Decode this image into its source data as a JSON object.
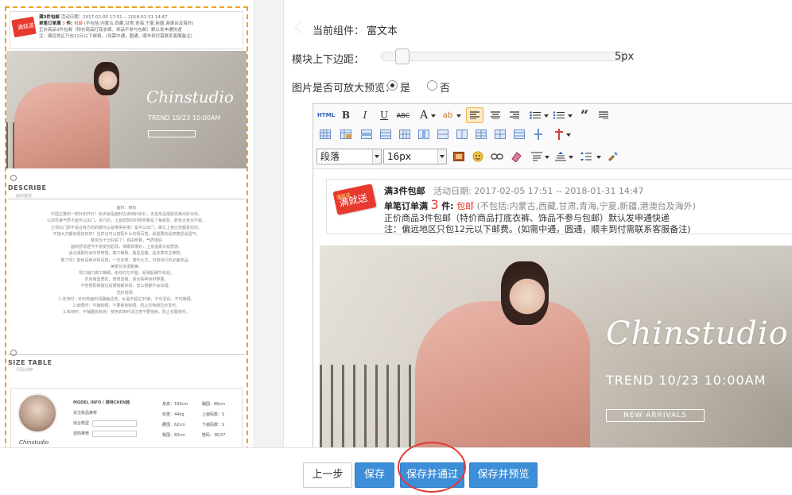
{
  "colors": {
    "accent": "#3d8ed8",
    "promo_red": "#e8392e",
    "dashed_border": "#f0a020",
    "annotation_red": "#e53935"
  },
  "preview": {
    "promo": {
      "line1_title": "满3件包邮",
      "line1_date": "活动日期：2017-02-05 17:51 -- 2018-01-31 14:47",
      "line2_prefix": "单笔订单满",
      "line2_num": "3",
      "line2_suffix": "件:",
      "line2_tag": "包邮",
      "line2_detail": "(不包括:内蒙古,西藏,甘肃,青海,宁夏,新疆,港澳台及海外)",
      "line3": "正价商品3件包邮（特价商品打底衣裤、饰品不参与包邮）默认发申通快递",
      "line4": "注：偏远地区只包12元以下邮费。(如需中通，圆通，顺丰到付需联系客服备注)",
      "tag_text": "满就送"
    },
    "hero_title": "Chinstudio",
    "hero_trend": "TREND 10/23 10:00AM",
    "describe_title": "DESCRIBE",
    "describe_sub": "面料描述",
    "describe_lines": [
      "面料：棉织",
      "中国主推的一款针织开衫！秋天就是面料应该纯针织衫，无需单品搭配完美出彩出现，",
      "以前优美气质不能可以出门，多行的，上面样款的时候穿着是了每条款，颜色大家也不错，",
      "立领出门即不适合有方的的都可以是哦得实哦！是可以出门，做工上身比较都喜欢的。",
      "不错大方都有很好的的！当然也可以搭配什么的很百搭，最重要的是穿着舒适透气。",
      "整体也十分好看了！自由穿着，气质很好",
      "面料舒适透气不易变形起球，保暖效果好，上身温柔又有质感。",
      "适合通勤约会日常穿搭，做工精致，版型显瘦，是本季的主推款。",
      "敬了吗？颜色是绝对的百搭，一衣多穿，简约大方，日常出行的必备单品。",
      "美丽又浪漫甜美。",
      "领口袖口做工精细，走线均匀平整，经得起细节考验。",
      "衣身版型宽松，遮肉显瘦，适合各种身材穿着。",
      "不管搭配裤装还是裙装都好看，怎么搭都不会出错。",
      "洗护说明：",
      "1.洗涤时：针织类面料请翻面清洗，水温不超过30度，不可漂白，不可暴晒。",
      "2.晾晒时：平铺晾晒，不要悬挂晾晒，防止衣物被拉长变形。",
      "3.收纳时：平铺叠放收纳，使用衣架时请注意不要挂肩，防止衣服变形。"
    ],
    "size_title": "SIZE TABLE",
    "size_sub": "尺码/试穿",
    "model_info": "MODEL INFO / 模特CHEN茜",
    "model_name": "关注新品推荐",
    "model_rows": [
      "适合款型",
      "选购推荐"
    ],
    "chin_logo": "Chinstudio",
    "measurements": [
      [
        "身高：160cm",
        "胸围：86cm"
      ],
      [
        "体重：44kg",
        "上装码数：S"
      ],
      [
        "腰围：62cm",
        "下装码数：S"
      ],
      [
        "臀围：83cm",
        "鞋码：36/37"
      ]
    ]
  },
  "panel": {
    "current_component_label": "当前组件：",
    "current_component_value": "富文本",
    "margin_label": "模块上下边距：",
    "margin_value": "5px",
    "margin_level": 0.05,
    "zoom_label": "图片是否可放大预览：",
    "zoom_yes": "是",
    "zoom_no": "否",
    "zoom_selected": "是"
  },
  "toolbar": {
    "html_label": "HTML",
    "paragraph_select": "段落",
    "font_size_select": "16px"
  },
  "content": {
    "promo": {
      "tag_text": "满就送",
      "tag_top": "满就送",
      "title": "满3件包邮",
      "date": "活动日期: 2017-02-05 17:51 -- 2018-01-31 14:47",
      "line2_prefix": "单笔订单满",
      "line2_num": "3",
      "line2_suffix": "件:",
      "line2_tag": "包邮",
      "line2_detail": "(不包括:内蒙古,西藏,甘肃,青海,宁夏,新疆,港澳台及海外)",
      "line3": "正价商品3件包邮（特价商品打底衣裤、饰品不参与包邮）默认发申通快递",
      "line4": "注：偏远地区只包12元以下邮费。(如需中通，圆通，顺丰到付需联系客服备注)"
    },
    "hero_title": "Chinstudio",
    "hero_trend": "TREND 10/23 10:00AM",
    "hero_new": "NEW ARRIVALS"
  },
  "footer": {
    "prev": "上一步",
    "save": "保存",
    "save_pass": "保存并通过",
    "save_preview": "保存并预览"
  }
}
